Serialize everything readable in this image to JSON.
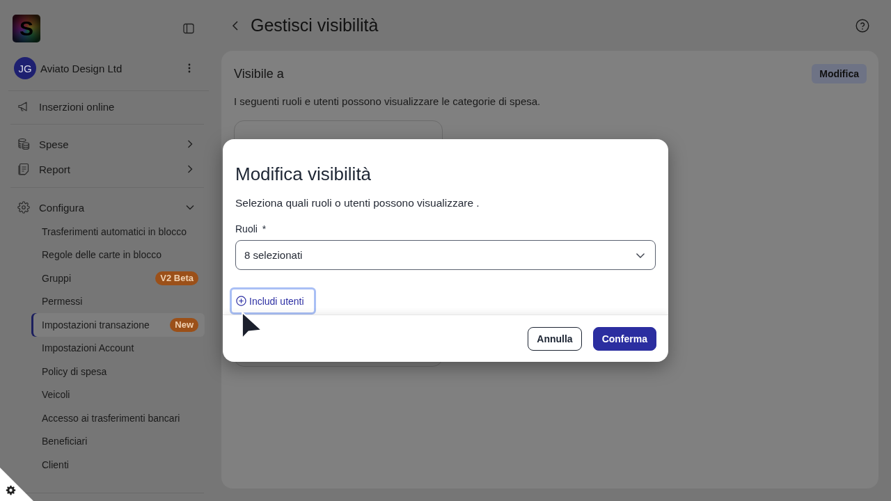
{
  "sidebar": {
    "logo": "S",
    "account": {
      "initials": "JG",
      "name": "Aviato Design Ltd"
    },
    "sections": [
      {
        "items": [
          {
            "label": "Inserzioni online"
          }
        ]
      },
      {
        "items": [
          {
            "label": "Spese",
            "expanded": false
          },
          {
            "label": "Report",
            "expanded": false
          }
        ]
      },
      {
        "items": [
          {
            "label": "Configura",
            "expanded": true,
            "children": [
              {
                "label": "Trasferimenti automatici in blocco",
                "selected": false
              },
              {
                "label": "Regole delle carte in blocco",
                "selected": false
              },
              {
                "label": "Gruppi",
                "selected": false,
                "badge": "V2 Beta"
              },
              {
                "label": "Permessi",
                "selected": false
              },
              {
                "label": "Impostazioni transazione",
                "selected": true,
                "badge": "New"
              },
              {
                "label": "Impostazioni Account",
                "selected": false
              },
              {
                "label": "Policy di spesa",
                "selected": false
              },
              {
                "label": "Veicoli",
                "selected": false
              },
              {
                "label": "Accesso ai trasferimenti bancari",
                "selected": false
              },
              {
                "label": "Beneficiari",
                "selected": false
              },
              {
                "label": "Clienti",
                "selected": false
              }
            ]
          }
        ]
      }
    ]
  },
  "header": {
    "title": "Gestisci visibilità"
  },
  "visibility_card": {
    "title": "Visibile a",
    "edit_button": "Modifica",
    "description": "I seguenti ruoli e utenti possono visualizzare le categorie di spesa."
  },
  "modal": {
    "title": "Modifica visibilità",
    "description": "Seleziona quali ruoli o utenti possono visualizzare .",
    "roles_field": {
      "label": "Ruoli",
      "required_mark": "*",
      "value": "8 selezionati"
    },
    "include_users_link": {
      "label": "Includi utenti",
      "focused": true
    },
    "buttons": [
      {
        "label": "Annulla",
        "kind": "secondary"
      },
      {
        "label": "Conferma",
        "kind": "primary"
      }
    ]
  }
}
